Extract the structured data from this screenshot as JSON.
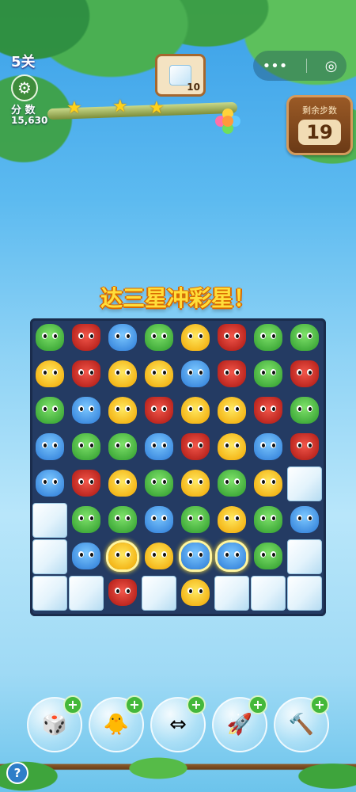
{
  "hud": {
    "level": "5关",
    "score_label": "分 数",
    "score": "15,630",
    "goal_count": "10",
    "moves_label": "剩余步数",
    "moves": "19"
  },
  "icons": {
    "settings": "gear-icon",
    "menu": "more-dots-icon",
    "close": "target-icon",
    "help": "?"
  },
  "banner": "达三星冲彩星！",
  "board": {
    "rows": 8,
    "cols": 8,
    "grid": [
      [
        "frog",
        "fox",
        "blob",
        "frog",
        "chick",
        "fox",
        "frog",
        "frog"
      ],
      [
        "chick",
        "fox",
        "chick",
        "chick",
        "blob",
        "fox",
        "frog",
        "fox"
      ],
      [
        "frog",
        "blob",
        "chick",
        "fox",
        "chick",
        "chick",
        "fox",
        "frog"
      ],
      [
        "blob",
        "frog",
        "frog",
        "blob",
        "fox",
        "chick",
        "blob",
        "fox"
      ],
      [
        "blob",
        "fox",
        "chick",
        "frog",
        "chick",
        "frog",
        "chick",
        "ice"
      ],
      [
        "ice",
        "frog",
        "frog",
        "blob",
        "frog",
        "chick",
        "frog",
        "blob"
      ],
      [
        "ice",
        "blob",
        "chick*",
        "chick",
        "blob*",
        "blob*",
        "frog",
        "ice"
      ],
      [
        "ice",
        "ice",
        "fox",
        "ice",
        "chick",
        "ice",
        "ice",
        "ice"
      ]
    ]
  },
  "boosters": [
    {
      "name": "shuffle-booster",
      "glyph": "🎲"
    },
    {
      "name": "swap-booster",
      "glyph": "🐥"
    },
    {
      "name": "arrow-booster",
      "glyph": "⇔"
    },
    {
      "name": "rocket-booster",
      "glyph": "🚀"
    },
    {
      "name": "hammer-booster",
      "glyph": "🔨"
    }
  ],
  "colors": {
    "board": "#243b63",
    "star": "#ffd21a",
    "moves_panel": "#7a4520"
  }
}
